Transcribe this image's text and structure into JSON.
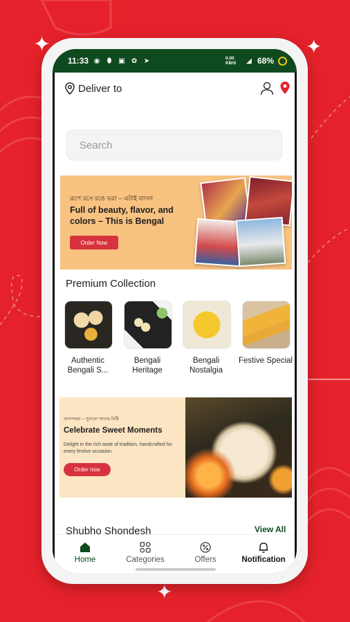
{
  "status_bar": {
    "time": "11:33",
    "data_rate": "0.00 KB/S",
    "battery": "68%"
  },
  "header": {
    "deliver_label": "Deliver to"
  },
  "search": {
    "placeholder": "Search"
  },
  "banner1": {
    "small_text": "রূপে রসে রঙে ভরা – এটাই বাংলা",
    "title": "Full of beauty, flavor, and colors – This is Bengal",
    "button": "Order Now"
  },
  "premium": {
    "title": "Premium Collection",
    "items": [
      {
        "label": "Authentic Bengali S..."
      },
      {
        "label": "Bengali Heritage"
      },
      {
        "label": "Bengali Nostalgia"
      },
      {
        "label": "Festive Special"
      }
    ]
  },
  "banner2": {
    "small_text": "আনন্দময় – পুরানো স্বাদের মিষ্টি",
    "title": "Celebrate Sweet Moments",
    "text": "Delight in the rich taste of tradition, handcrafted for every festive occasion.",
    "button": "Order now"
  },
  "shondesh": {
    "title": "Shubho Shondesh",
    "view_all": "View All"
  },
  "nav": {
    "home": "Home",
    "categories": "Categories",
    "offers": "Offers",
    "notification": "Notification"
  },
  "colors": {
    "brand_red": "#e5222b",
    "brand_green": "#0e4a1e",
    "banner_peach": "#f8c281",
    "banner_cream": "#fbe5c2"
  }
}
